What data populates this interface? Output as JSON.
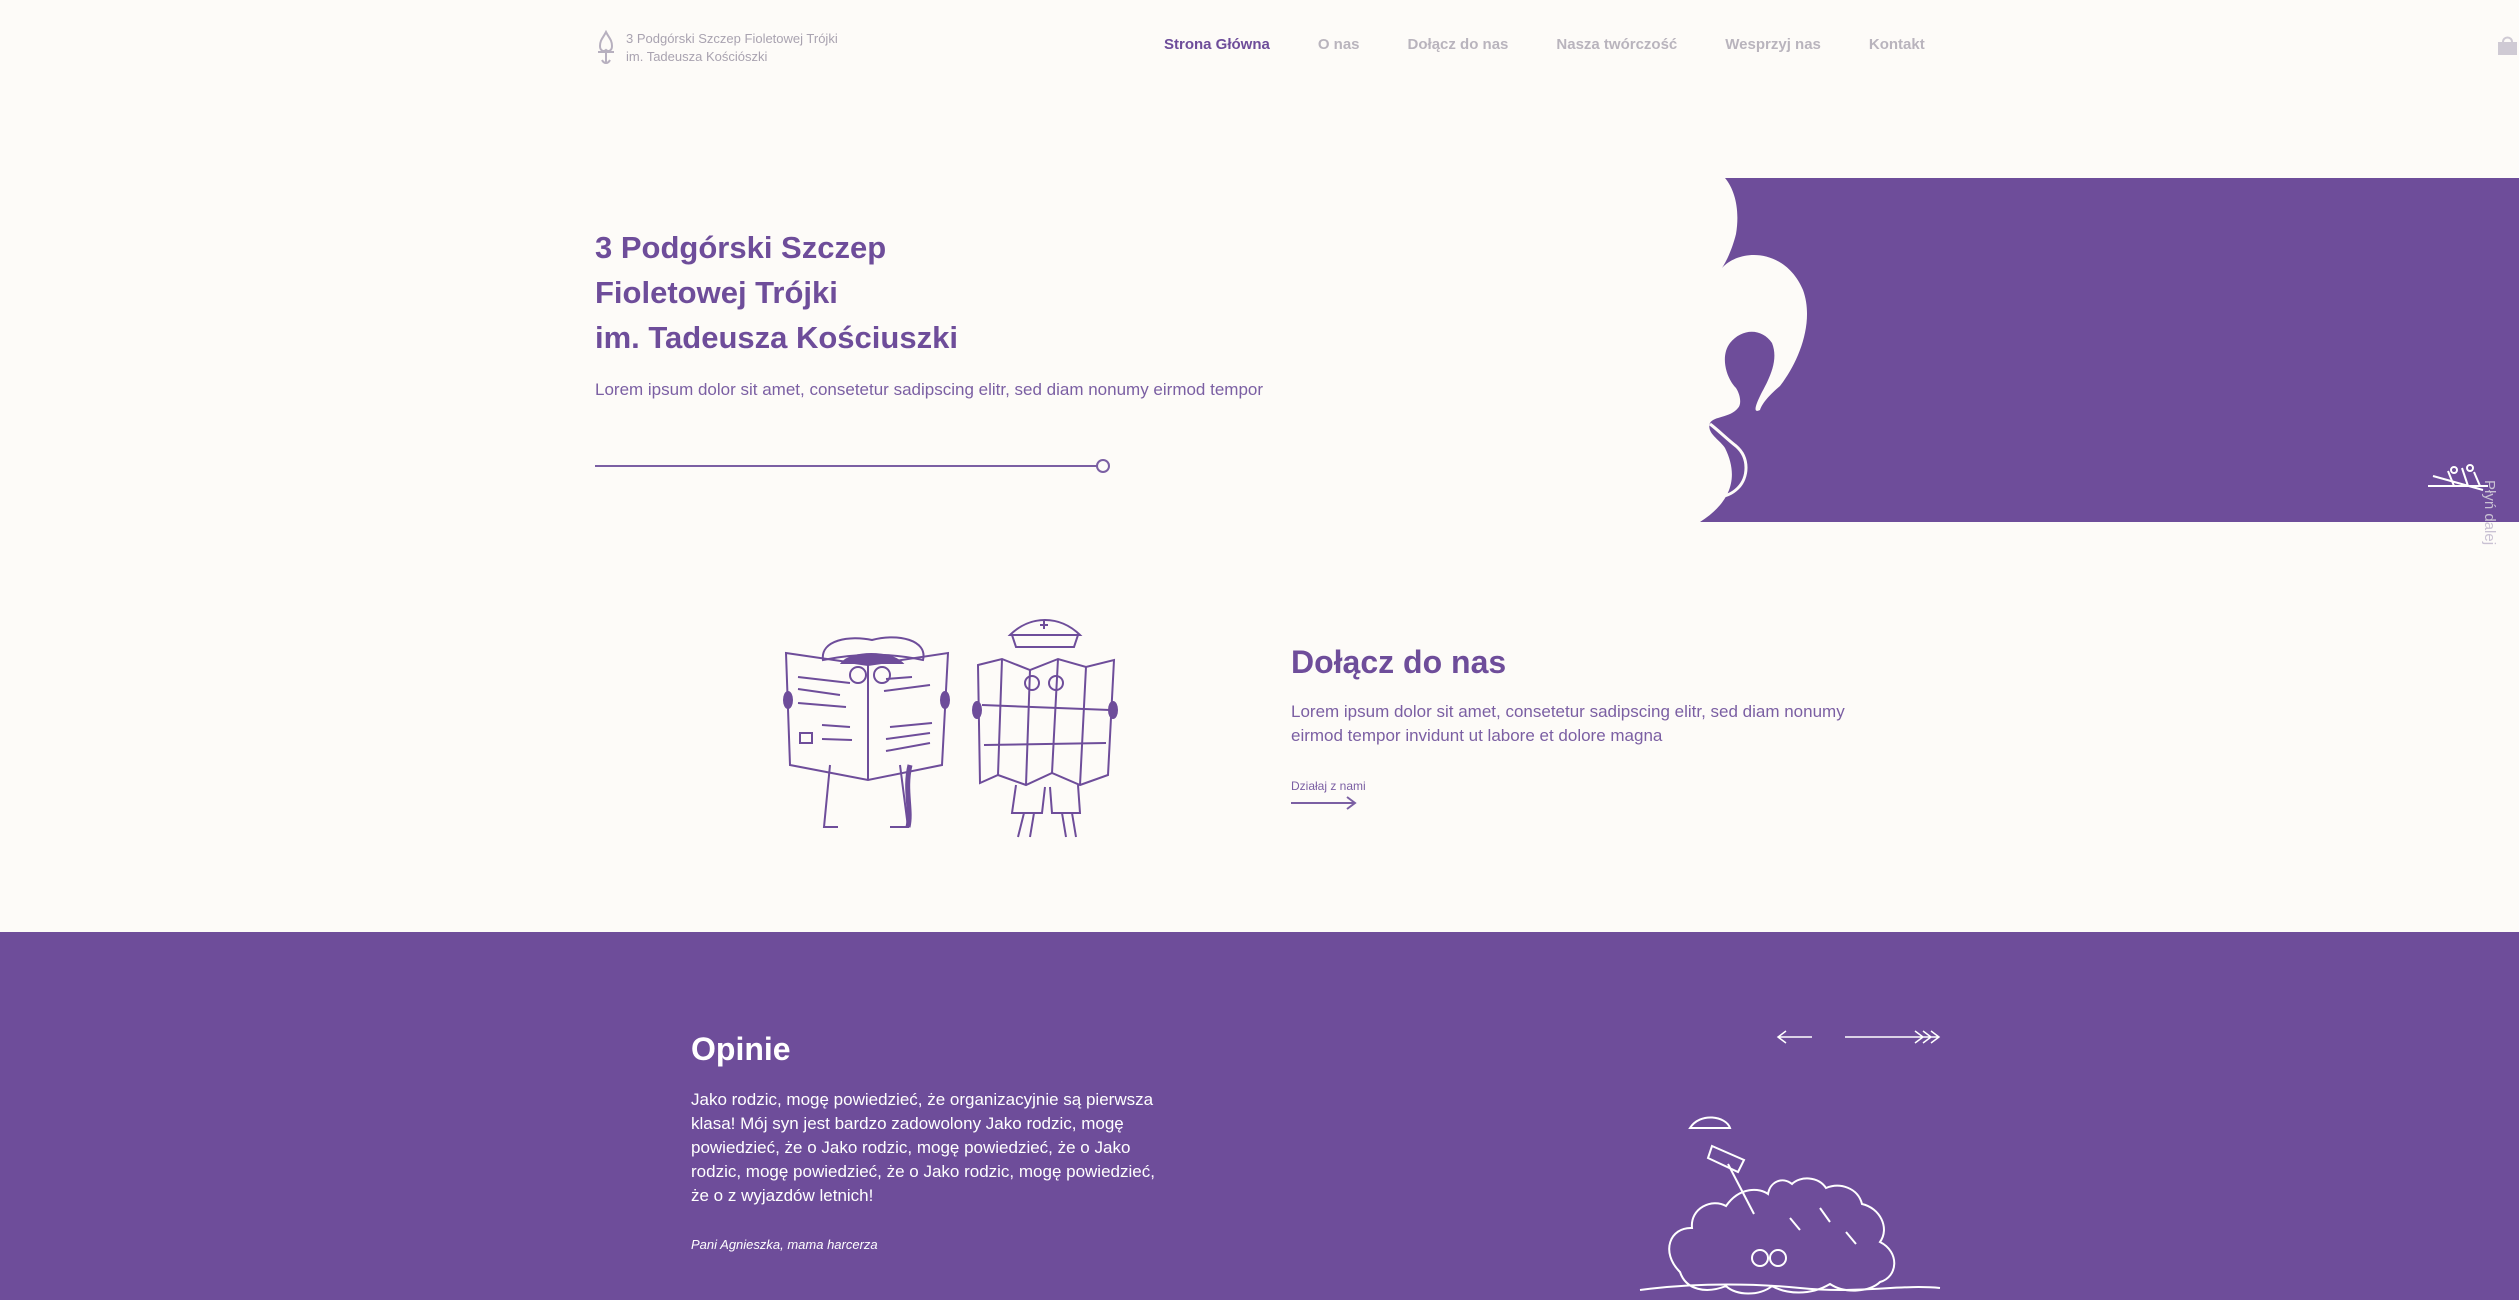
{
  "header": {
    "logo_line1": "3 Podgórski Szczep Fioletowej Trójki",
    "logo_line2": "im. Tadeusza Kościószki",
    "nav": [
      {
        "label": "Strona Główna",
        "active": true
      },
      {
        "label": "O nas"
      },
      {
        "label": "Dołącz do nas"
      },
      {
        "label": "Nasza twórczość"
      },
      {
        "label": "Wesprzyj nas"
      },
      {
        "label": "Kontakt"
      }
    ]
  },
  "hero": {
    "title_line1": "3 Podgórski Szczep",
    "title_line2": "Fioletowej Trójki",
    "title_line3": "im. Tadeusza Kościuszki",
    "text": "Lorem ipsum dolor sit amet, consetetur sadipscing elitr, sed diam nonumy eirmod tempor",
    "scroll_label": "Płyń dalej"
  },
  "join": {
    "title": "Dołącz do nas",
    "text": "Lorem ipsum dolor sit amet, consetetur sadipscing elitr, sed diam nonumy eirmod tempor invidunt ut labore et dolore magna",
    "link": "Działaj z nami"
  },
  "opinions": {
    "title": "Opinie",
    "text": "Jako rodzic, mogę powiedzieć, że organizacyjnie są pierwsza klasa! Mój syn jest bardzo zadowolony Jako rodzic, mogę powiedzieć, że o Jako rodzic, mogę powiedzieć, że o Jako rodzic, mogę powiedzieć, że o Jako rodzic, mogę powiedzieć, że o z wyjazdów letnich!",
    "author": "Pani Agnieszka, mama harcerza"
  },
  "colors": {
    "accent": "#6e4d9a",
    "background": "#fdfbf8",
    "nav_inactive": "#b9b4bd"
  }
}
